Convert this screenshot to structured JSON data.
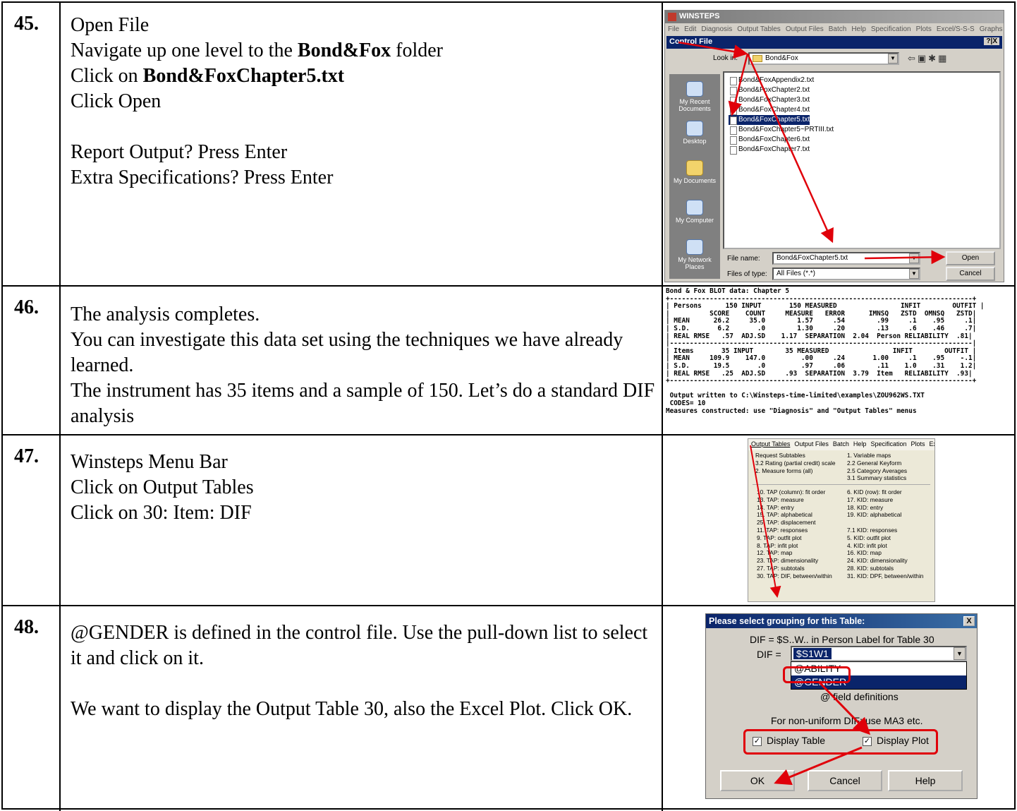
{
  "steps": [
    {
      "number": "45.",
      "lines": [
        {
          "pre": "Open File"
        },
        {
          "pre": "Navigate up one level to the ",
          "bold": "Bond&Fox",
          "post": " folder"
        },
        {
          "pre": "Click on ",
          "bold": "Bond&FoxChapter5.txt"
        },
        {
          "pre": "Click Open"
        },
        {
          "pre": "Report Output?  Press Enter"
        },
        {
          "pre": "Extra Specifications? Press Enter"
        }
      ]
    },
    {
      "number": "46.",
      "lines": [
        {
          "pre": "The analysis completes."
        },
        {
          "pre": "You can investigate this data set using the techniques we have already learned."
        },
        {
          "pre": "The instrument has 35 items and a sample of 150. Let’s do a standard DIF analysis"
        }
      ]
    },
    {
      "number": "47.",
      "lines": [
        {
          "pre": "Winsteps Menu Bar"
        },
        {
          "pre": "Click on Output Tables"
        },
        {
          "pre": "Click on 30: Item: DIF"
        }
      ]
    },
    {
      "number": "48.",
      "lines": [
        {
          "pre": "@GENDER is defined in the control file. Use the pull-down list to select it and click on it."
        },
        {
          "pre": "We want to display the Output Table 30, also the Excel Plot. Click OK."
        }
      ]
    }
  ],
  "shot45": {
    "app_title": "WINSTEPS",
    "menu": [
      "File",
      "Edit",
      "Diagnosis",
      "Output Tables",
      "Output Files",
      "Batch",
      "Help",
      "Specification",
      "Plots",
      "Excel/S-S-S",
      "Graphs",
      "Da"
    ],
    "dialog_title": "Control File",
    "dialog_help": "?|X",
    "look_in_label": "Look in:",
    "look_in_value": "Bond&Fox",
    "places": [
      "My Recent Documents",
      "Desktop",
      "My Documents",
      "My Computer",
      "My Network Places"
    ],
    "files": [
      "Bond&FoxAppendix2.txt",
      "Bond&FoxChapter2.txt",
      "Bond&FoxChapter3.txt",
      "Bond&FoxChapter4.txt",
      "Bond&FoxChapter5.txt",
      "Bond&FoxChapter5~PRTIII.txt",
      "Bond&FoxChapter6.txt",
      "Bond&FoxChapter7.txt"
    ],
    "selected_index": 4,
    "file_name_label": "File name:",
    "file_name_value": "Bond&FoxChapter5.txt",
    "file_type_label": "Files of type:",
    "file_type_value": "All Files (*.*)",
    "open_button": "Open",
    "cancel_button": "Cancel"
  },
  "shot46": {
    "lines": [
      "Bond & Fox BLOT data: Chapter 5",
      "+----------------------------------------------------------------------------+",
      "| Persons      150 INPUT       150 MEASURED                INFIT        OUTFIT |",
      "|          SCORE    COUNT     MEASURE   ERROR      IMNSQ   ZSTD  OMNSQ   ZSTD|",
      "| MEAN      26.2     35.0        1.57     .54        .99     .1    .95     .1|",
      "| S.D.       6.2       .0        1.30     .20        .13     .6    .46     .7|",
      "| REAL RMSE   .57  ADJ.SD    1.17  SEPARATION  2.04  Person RELIABILITY  .81|",
      "|----------------------------------------------------------------------------|",
      "| Items       35 INPUT        35 MEASURED                INFIT        OUTFIT |",
      "| MEAN     109.9    147.0         .00     .24       1.00     .1    .95    -.1|",
      "| S.D.      19.5       .0         .97     .06        .11    1.0    .31    1.2|",
      "| REAL RMSE   .25  ADJ.SD     .93  SEPARATION  3.79  Item   RELIABILITY  .93|",
      "+----------------------------------------------------------------------------+",
      " Output written to C:\\Winsteps-time-limited\\examples\\ZOU962WS.TXT",
      " CODES= 10",
      "Measures constructed: use \"Diagnosis\" and \"Output Tables\" menus"
    ]
  },
  "shot47": {
    "menu": [
      "Output Tables",
      "Output Files",
      "Batch",
      "Help",
      "Specification",
      "Plots",
      "Exce"
    ],
    "left_top": [
      "Request Subtables",
      "3.2  Rating (partial credit) scale",
      "2. Measure forms (all)"
    ],
    "right_top": [
      "1. Variable maps",
      "2.2 General Keyform",
      "2.5 Category Averages",
      "3.1 Summary statistics"
    ],
    "left_items": [
      "10. TAP (column): fit order",
      "13. TAP: measure",
      "14. TAP: entry",
      "15. TAP: alphabetical",
      "25. TAP: displacement",
      "11. TAP: responses",
      "9. TAP: outfit plot",
      "8. TAP: infit plot",
      "12. TAP: map",
      "23. TAP: dimensionality",
      "27. TAP: subtotals",
      "30. TAP: DIF, between/within"
    ],
    "right_items": [
      "6. KID (row): fit order",
      "17. KID: measure",
      "18. KID: entry",
      "19. KID: alphabetical",
      "",
      "7.1 KID: responses",
      "5. KID: outfit plot",
      "4. KID: infit plot",
      "16. KID: map",
      "24. KID: dimensionality",
      "28. KID: subtotals",
      "31. KID: DPF, between/within"
    ]
  },
  "shot48": {
    "title": "Please select grouping for this Table:",
    "close": "X",
    "subtitle": "DIF = $S..W.. in Person Label for Table 30",
    "dif_label": "DIF =",
    "dif_value": "$S1W1",
    "options": [
      "@ABILITY",
      "@GENDER"
    ],
    "selected_option": 1,
    "field_defs": "@ field definitions",
    "nonuniform": "For non-uniform DIF: use MA3 etc.",
    "display_table": "Display Table",
    "display_plot": "Display Plot",
    "check_mark": "✓",
    "ok": "OK",
    "cancel": "Cancel",
    "help": "Help"
  }
}
